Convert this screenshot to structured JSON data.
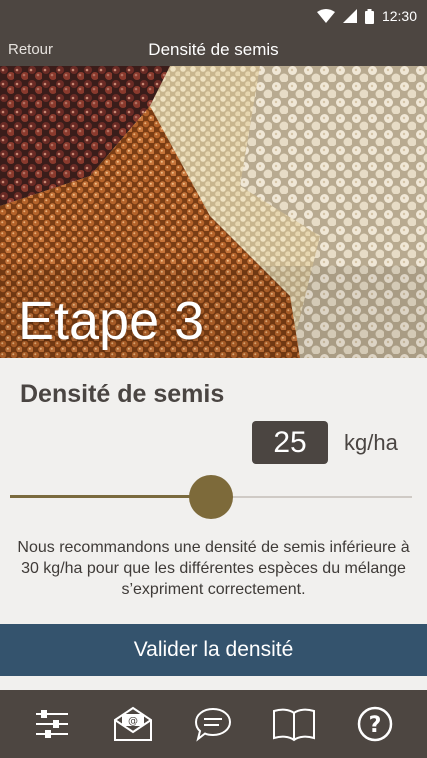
{
  "status_bar": {
    "time": "12:30"
  },
  "header": {
    "back_label": "Retour",
    "title": "Densité de semis"
  },
  "hero": {
    "step_label": "Etape 3",
    "image": "quinoa-seeds-photo"
  },
  "density": {
    "section_title": "Densité de semis",
    "value": "25",
    "unit": "kg/ha",
    "slider_fraction": 0.5
  },
  "description": "Nous recommandons une densité de semis inférieure à 30 kg/ha pour que les différentes espèces du mélange s’expriment correctement.",
  "validate_button": "Valider la densité",
  "bottom_nav": [
    {
      "icon": "settings-sliders-icon"
    },
    {
      "icon": "email-icon"
    },
    {
      "icon": "chat-icon"
    },
    {
      "icon": "book-icon"
    },
    {
      "icon": "help-icon"
    }
  ],
  "colors": {
    "bar_bg": "#4d4641",
    "accent_button": "#34536d",
    "slider_thumb": "#7d6a3a",
    "value_box": "#4b4541",
    "page_bg": "#f1f0ee"
  }
}
